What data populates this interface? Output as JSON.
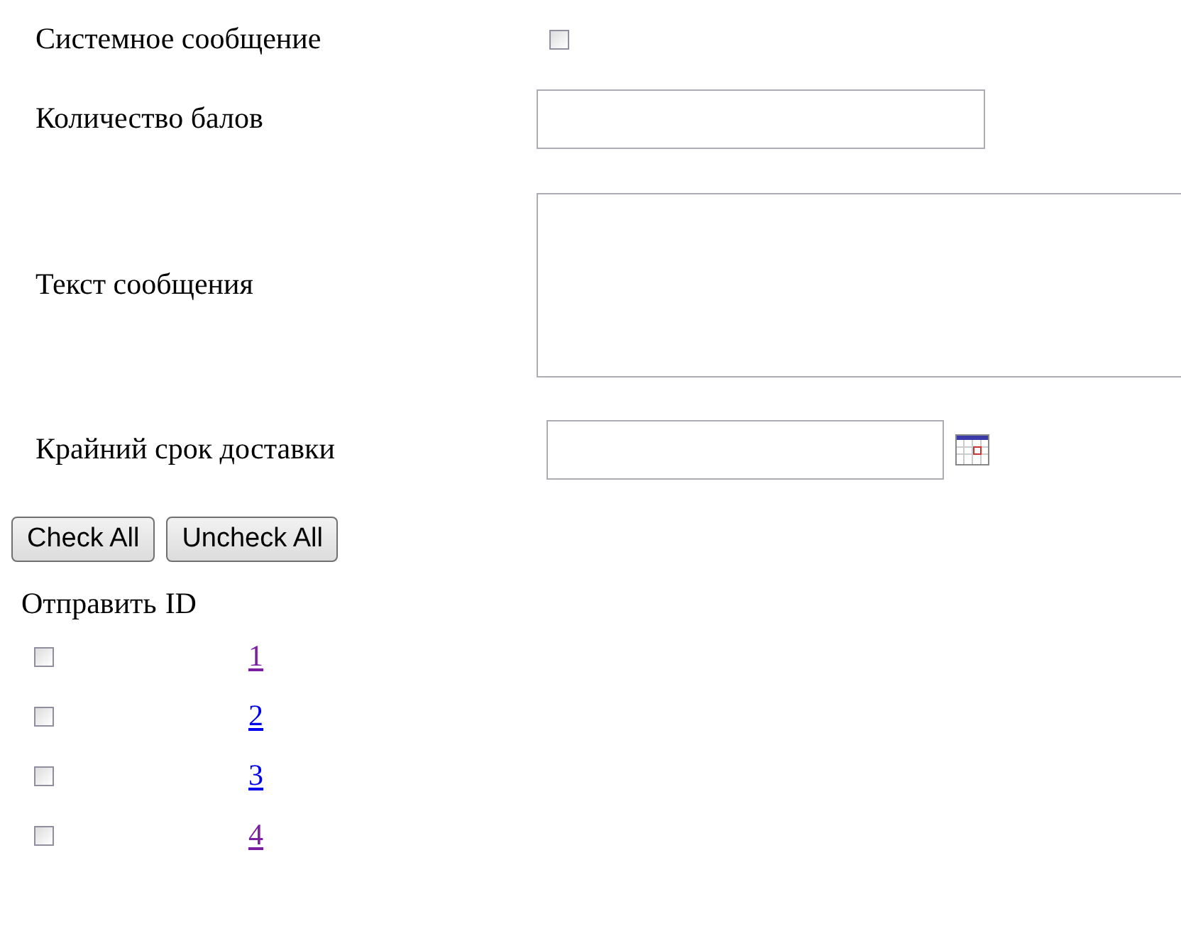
{
  "form": [
    {
      "kind": "checkbox",
      "label": "Системное сообщение",
      "checked": false
    },
    {
      "kind": "text",
      "label": "Количество балов"
    },
    {
      "kind": "textarea",
      "label": "Текст сообщения"
    },
    {
      "kind": "date",
      "label": "Крайний срок доставки"
    }
  ],
  "buttons": [
    "Check All",
    "Uncheck All"
  ],
  "table": {
    "columns": [
      "Отправить",
      "ID"
    ],
    "rows": [
      {
        "checked": false,
        "id": "1",
        "visited": true
      },
      {
        "checked": false,
        "id": "2",
        "visited": false
      },
      {
        "checked": false,
        "id": "3",
        "visited": false
      },
      {
        "checked": false,
        "id": "4",
        "visited": true
      }
    ]
  }
}
